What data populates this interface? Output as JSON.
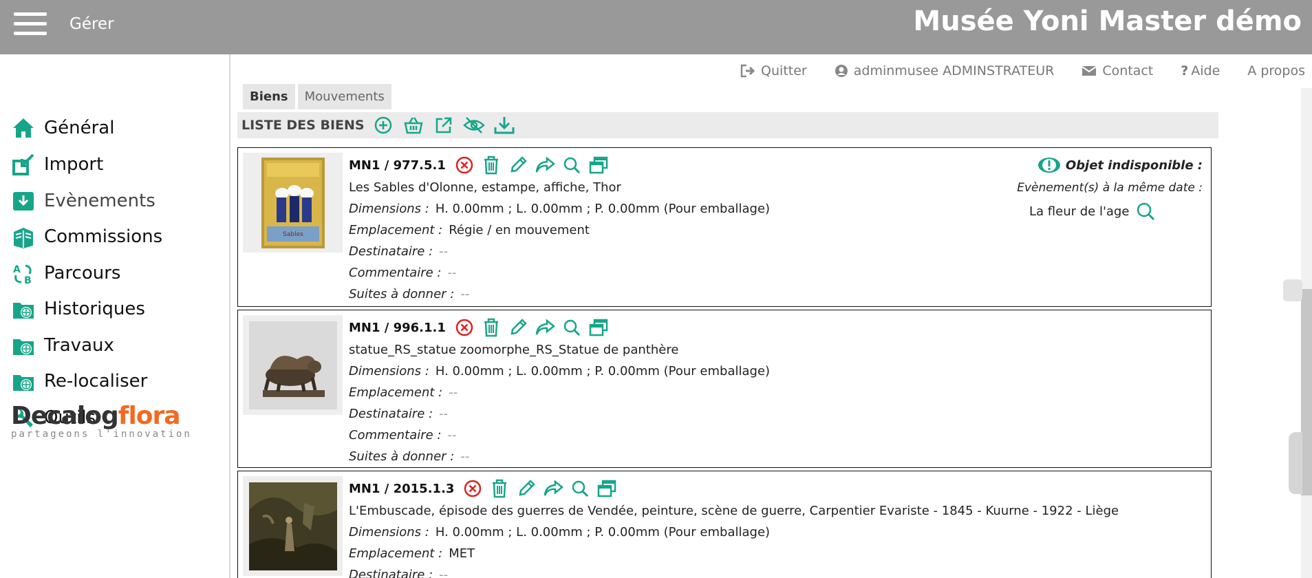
{
  "header": {
    "menu_label": "Gérer",
    "app_title": "Musée Yoni Master démo"
  },
  "sidebar": {
    "items": [
      {
        "label": "Général",
        "icon": "home-icon"
      },
      {
        "label": "Import",
        "icon": "import-icon"
      },
      {
        "label": "Evènements",
        "icon": "download-box-icon"
      },
      {
        "label": "Commissions",
        "icon": "books-icon"
      },
      {
        "label": "Parcours",
        "icon": "route-icon"
      },
      {
        "label": "Historiques",
        "icon": "folder-globe-icon"
      },
      {
        "label": "Travaux",
        "icon": "folder-globe-icon"
      },
      {
        "label": "Re-localiser",
        "icon": "folder-globe-icon"
      },
      {
        "label": "Outils",
        "icon": "wrench-icon"
      }
    ],
    "logo": {
      "part1": "Decalog",
      "part2": "flora",
      "tagline": "partageons l'innovation"
    }
  },
  "toplinks": {
    "quit": "Quitter",
    "user": "adminmusee ADMINSTRATEUR",
    "contact": "Contact",
    "help": "Aide",
    "about": "A propos"
  },
  "tabs": {
    "biens": "Biens",
    "mouvements": "Mouvements"
  },
  "list": {
    "title": "LISTE DES BIENS"
  },
  "labels": {
    "dimensions": "Dimensions :",
    "emplacement": "Emplacement :",
    "destinataire": "Destinataire :",
    "commentaire": "Commentaire :",
    "suites": "Suites à donner :"
  },
  "items": [
    {
      "ref": "MN1 / 977.5.1",
      "title": "Les Sables d'Olonne, estampe, affiche, Thor",
      "dimensions": "H. 0.00mm ; L. 0.00mm ; P. 0.00mm (Pour emballage)",
      "emplacement": "Régie / en mouvement",
      "destinataire": "--",
      "commentaire": "--",
      "suites": "--",
      "unavailable": {
        "title": "Objet indisponible :",
        "subtitle": "Evènement(s) à la même date :",
        "event": "La fleur de l'age"
      }
    },
    {
      "ref": "MN1 / 996.1.1",
      "title": "statue_RS_statue zoomorphe_RS_Statue de panthère",
      "dimensions": "H. 0.00mm ; L. 0.00mm ; P. 0.00mm (Pour emballage)",
      "emplacement": "--",
      "destinataire": "--",
      "commentaire": "--",
      "suites": "--"
    },
    {
      "ref": "MN1 / 2015.1.3",
      "title": "L'Embuscade, épisode des guerres de Vendée, peinture, scène de guerre, Carpentier Evariste - 1845 - Kuurne - 1922 - Liège",
      "dimensions": "H. 0.00mm ; L. 0.00mm ; P. 0.00mm (Pour emballage)",
      "emplacement": "MET",
      "destinataire": "--"
    }
  ],
  "colors": {
    "accent": "#17a589",
    "danger": "#e02020",
    "topbar": "#999999"
  }
}
